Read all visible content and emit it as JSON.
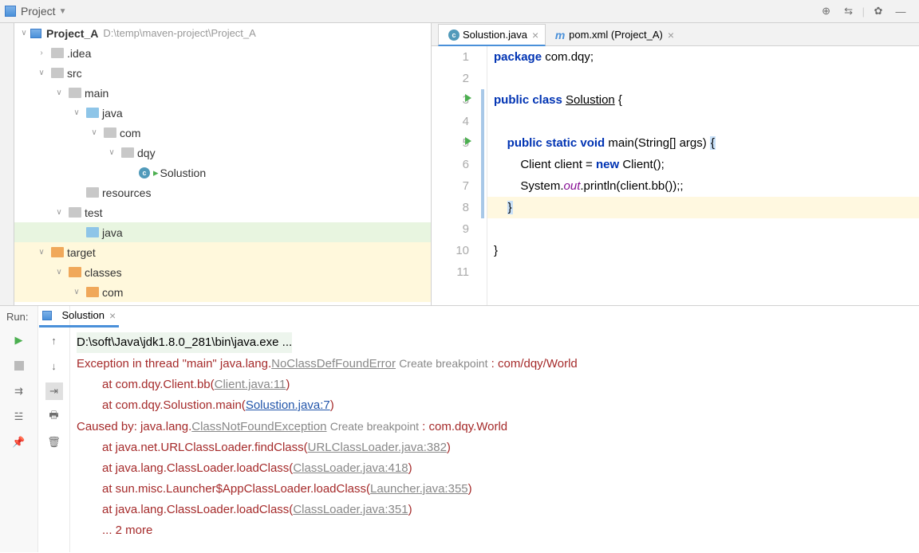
{
  "header": {
    "project_label": "Project"
  },
  "tree": {
    "root": "Project_A",
    "root_path": "D:\\temp\\maven-project\\Project_A",
    "nodes": [
      {
        "label": ".idea",
        "depth": 1,
        "arrow": "right",
        "icon": "gray"
      },
      {
        "label": "src",
        "depth": 1,
        "arrow": "down",
        "icon": "gray"
      },
      {
        "label": "main",
        "depth": 2,
        "arrow": "down",
        "icon": "gray"
      },
      {
        "label": "java",
        "depth": 3,
        "arrow": "down",
        "icon": "blue"
      },
      {
        "label": "com",
        "depth": 4,
        "arrow": "down",
        "icon": "gray"
      },
      {
        "label": "dqy",
        "depth": 5,
        "arrow": "down",
        "icon": "gray"
      },
      {
        "label": "Solustion",
        "depth": 6,
        "arrow": "",
        "icon": "java"
      },
      {
        "label": "resources",
        "depth": 3,
        "arrow": "",
        "icon": "gray"
      },
      {
        "label": "test",
        "depth": 2,
        "arrow": "down",
        "icon": "gray"
      },
      {
        "label": "java",
        "depth": 3,
        "arrow": "",
        "icon": "blue",
        "hl": "green"
      },
      {
        "label": "target",
        "depth": 1,
        "arrow": "down",
        "icon": "orange",
        "hl": "yellow"
      },
      {
        "label": "classes",
        "depth": 2,
        "arrow": "down",
        "icon": "orange",
        "hl": "yellow"
      },
      {
        "label": "com",
        "depth": 3,
        "arrow": "down",
        "icon": "orange",
        "hl": "yellow"
      }
    ]
  },
  "tabs": {
    "active": "Solustion.java",
    "second": "pom.xml (Project_A)"
  },
  "code": {
    "lines": [
      {
        "n": "1",
        "html": "<span class='kw'>package</span> com.dqy;"
      },
      {
        "n": "2",
        "html": ""
      },
      {
        "n": "3",
        "html": "<span class='kw'>public class</span> <span class='underline'>Solustion</span> {",
        "run": true,
        "bar": true
      },
      {
        "n": "4",
        "html": "",
        "bar": true
      },
      {
        "n": "5",
        "html": "    <span class='kw'>public static void</span> main(String[] args) <span class='hl-brace'>{</span>",
        "run": true,
        "bar": true
      },
      {
        "n": "6",
        "html": "        Client client = <span class='kw'>new</span> Client();",
        "bar": true
      },
      {
        "n": "7",
        "html": "        System.<span class='static-kw'>out</span>.println(client.bb());;",
        "bar": true
      },
      {
        "n": "8",
        "html": "    <span class='hl-brace'>}</span>",
        "bar": true,
        "yellowbg": true
      },
      {
        "n": "9",
        "html": ""
      },
      {
        "n": "10",
        "html": "}"
      },
      {
        "n": "11",
        "html": ""
      }
    ]
  },
  "run": {
    "label": "Run:",
    "tab_name": "Solustion",
    "console": [
      {
        "cls": "cmd-line",
        "text": "D:\\soft\\Java\\jdk1.8.0_281\\bin\\java.exe ..."
      },
      {
        "cls": "err",
        "html": "Exception in thread \"main\" java.lang.<span class='link-gray'>NoClassDefFoundError</span> <span class='create-bp'>Create breakpoint</span> : com/dqy/World"
      },
      {
        "cls": "err indent1",
        "html": "at com.dqy.Client.bb(<span class='link-gray'>Client.java:11</span>)"
      },
      {
        "cls": "err indent1",
        "html": "at com.dqy.Solustion.main(<span class='link'>Solustion.java:7</span>)"
      },
      {
        "cls": "err",
        "html": "Caused by: java.lang.<span class='link-gray'>ClassNotFoundException</span> <span class='create-bp'>Create breakpoint</span> : com.dqy.World"
      },
      {
        "cls": "err indent1",
        "html": "at java.net.URLClassLoader.findClass(<span class='link-gray'>URLClassLoader.java:382</span>)"
      },
      {
        "cls": "err indent1",
        "html": "at java.lang.ClassLoader.loadClass(<span class='link-gray'>ClassLoader.java:418</span>)"
      },
      {
        "cls": "err indent1",
        "html": "at sun.misc.Launcher$AppClassLoader.loadClass(<span class='link-gray'>Launcher.java:355</span>)"
      },
      {
        "cls": "err indent1",
        "html": "at java.lang.ClassLoader.loadClass(<span class='link-gray'>ClassLoader.java:351</span>)"
      },
      {
        "cls": "err indent1",
        "html": "... 2 more"
      }
    ]
  }
}
